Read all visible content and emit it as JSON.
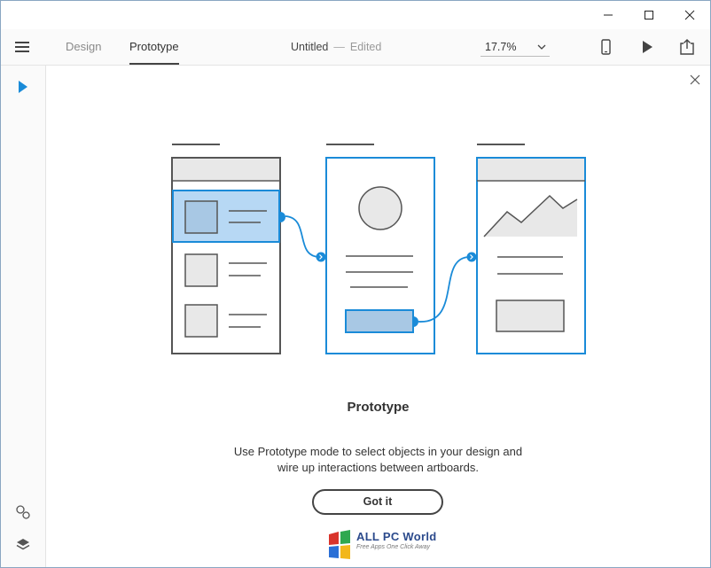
{
  "header": {
    "tabs": [
      {
        "label": "Design",
        "active": false
      },
      {
        "label": "Prototype",
        "active": true
      }
    ],
    "document": {
      "name": "Untitled",
      "separator": "—",
      "status": "Edited"
    },
    "zoom": "17.7%"
  },
  "icons": {
    "menu": "hamburger-menu-icon",
    "zoom_dropdown": "chevron-down-icon",
    "device_preview": "phone-icon",
    "play": "play-icon",
    "share": "share-icon",
    "select_tool": "arrow-select-icon",
    "assets": "symbols-icon",
    "layers": "layers-icon",
    "close": "close-icon"
  },
  "onboarding": {
    "title": "Prototype",
    "description_lines": [
      "Use Prototype mode to select objects in your design and",
      "wire up interactions between artboards."
    ],
    "button_label": "Got it"
  },
  "watermark": {
    "title": "ALL PC World",
    "subtitle": "Free Apps One Click Away"
  },
  "colors": {
    "accent": "#1a8bd8",
    "highlight_fill": "#b7d8f4",
    "wire_gray": "#555555",
    "placeholder_fill": "#e8e8e8"
  }
}
